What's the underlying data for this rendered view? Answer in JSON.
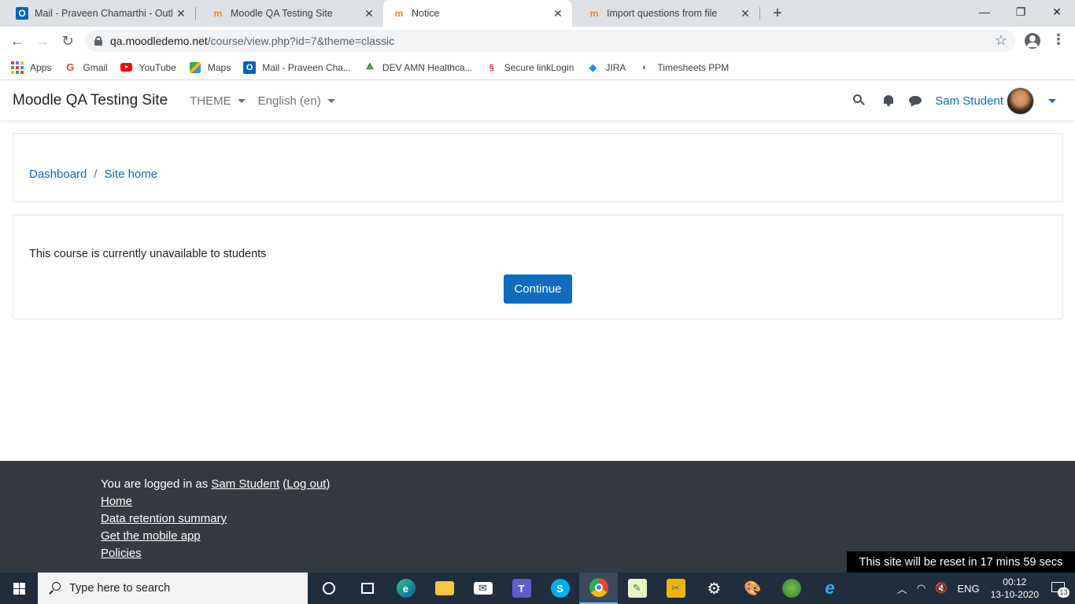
{
  "browser": {
    "tabs": [
      {
        "title": "Mail - Praveen Chamarthi - Outlo",
        "icon": "outlook-icon",
        "color": "#0364b8",
        "active": false
      },
      {
        "title": "Moodle QA Testing Site",
        "icon": "moodle-icon",
        "color": "#f98012",
        "active": false
      },
      {
        "title": "Notice",
        "icon": "moodle-icon",
        "color": "#f98012",
        "active": true
      },
      {
        "title": "Import questions from file",
        "icon": "moodle-icon",
        "color": "#f98012",
        "active": false
      }
    ],
    "close_glyph": "✕",
    "new_tab_glyph": "+",
    "url_host": "qa.moodledemo.net",
    "url_path": "/course/view.php?id=7&theme=classic",
    "bookmarks": [
      {
        "label": "Apps",
        "icon": "apps-grid-icon"
      },
      {
        "label": "Gmail",
        "icon": "google-icon"
      },
      {
        "label": "YouTube",
        "icon": "youtube-icon"
      },
      {
        "label": "Maps",
        "icon": "maps-icon"
      },
      {
        "label": "Mail - Praveen Cha...",
        "icon": "outlook-icon"
      },
      {
        "label": "DEV AMN Healthca...",
        "icon": "amn-icon"
      },
      {
        "label": "Secure linkLogin",
        "icon": "secure-link-icon"
      },
      {
        "label": "JIRA",
        "icon": "jira-icon"
      },
      {
        "label": "Timesheets PPM",
        "icon": "timesheets-icon"
      }
    ]
  },
  "moodle": {
    "site_name": "Moodle QA Testing Site",
    "theme_menu": "THEME",
    "language_menu": "English ‎(en)‎",
    "user_name": "Sam Student",
    "breadcrumb": [
      "Dashboard",
      "Site home"
    ],
    "breadcrumb_sep": "/",
    "notice_text": "This course is currently unavailable to students",
    "continue_label": "Continue",
    "brand_color": "#0f6cbf"
  },
  "footer": {
    "logged_in_prefix": "You are logged in as ",
    "logged_in_user": "Sam Student",
    "logout_open": " (",
    "logout_label": "Log out",
    "logout_close": ")",
    "links": [
      "Home",
      "Data retention summary",
      "Get the mobile app",
      "Policies"
    ],
    "reset_banner": "This site will be reset in 17 mins 59 secs"
  },
  "taskbar": {
    "search_placeholder": "Type here to search",
    "tray_lang": "ENG",
    "time": "00:12",
    "date": "13-10-2020",
    "notification_count": "13"
  }
}
